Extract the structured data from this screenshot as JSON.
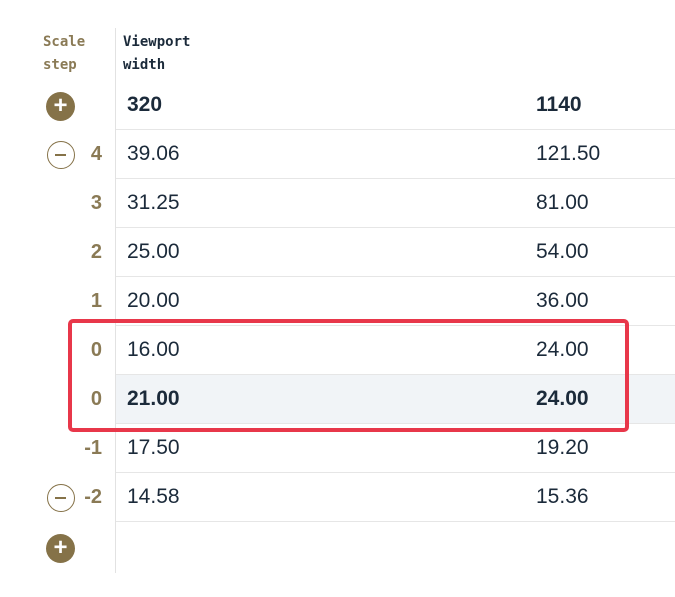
{
  "headers": {
    "scale_step": "Scale\nstep",
    "viewport_width": "Viewport\nwidth"
  },
  "viewport_row": {
    "min": "320",
    "max": "1140"
  },
  "rows": [
    {
      "step": "4",
      "min": "39.06",
      "max": "121.50"
    },
    {
      "step": "3",
      "min": "31.25",
      "max": "81.00"
    },
    {
      "step": "2",
      "min": "25.00",
      "max": "54.00"
    },
    {
      "step": "1",
      "min": "20.00",
      "max": "36.00"
    },
    {
      "step": "0",
      "min": "16.00",
      "max": "24.00"
    },
    {
      "step": "0",
      "min": "21.00",
      "max": "24.00"
    },
    {
      "step": "-1",
      "min": "17.50",
      "max": "19.20"
    },
    {
      "step": "-2",
      "min": "14.58",
      "max": "15.36"
    }
  ],
  "icons": {
    "add_top": "plus-circle-icon",
    "remove_top": "minus-circle-icon",
    "remove_bottom": "minus-circle-icon",
    "add_bottom": "plus-circle-icon"
  },
  "colors": {
    "accent": "#857248",
    "highlight_border": "#e8374a",
    "text": "#1b2a3a"
  }
}
